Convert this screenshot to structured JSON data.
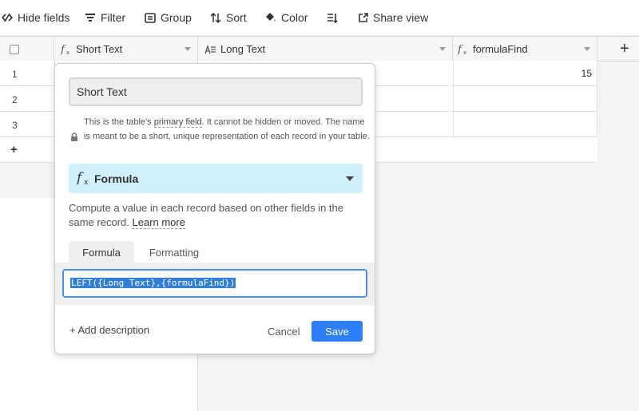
{
  "toolbar": {
    "hide_fields": "Hide fields",
    "filter": "Filter",
    "group": "Group",
    "sort": "Sort",
    "color": "Color",
    "share_view": "Share view"
  },
  "columns": [
    {
      "name": "Short Text",
      "icon": "formula-icon"
    },
    {
      "name": "Long Text",
      "icon": "long-text-icon"
    },
    {
      "name": "formulaFind",
      "icon": "formula-icon"
    }
  ],
  "rows": [
    {
      "num": "1",
      "formulaFind": "15"
    },
    {
      "num": "2",
      "formulaFind": ""
    },
    {
      "num": "3",
      "formulaFind": ""
    }
  ],
  "add_row": "+",
  "add_column": "+",
  "popup": {
    "field_name": "Short Text",
    "primary_note_pre": "This is the table's ",
    "primary_note_link": "primary field",
    "primary_note_post": ". It cannot be hidden or moved. The name is meant to be a short, unique representation of each record in your table.",
    "field_type": "Formula",
    "description_text": "Compute a value in each record based on other fields in the same record. ",
    "learn_more": "Learn more",
    "tabs": [
      "Formula",
      "Formatting"
    ],
    "formula": "LEFT({Long Text},{formulaFind})",
    "add_description": "+ Add description",
    "cancel": "Cancel",
    "save": "Save"
  },
  "colors": {
    "accent": "#2d7ff9",
    "type_select_bg": "#d0f0fb"
  }
}
